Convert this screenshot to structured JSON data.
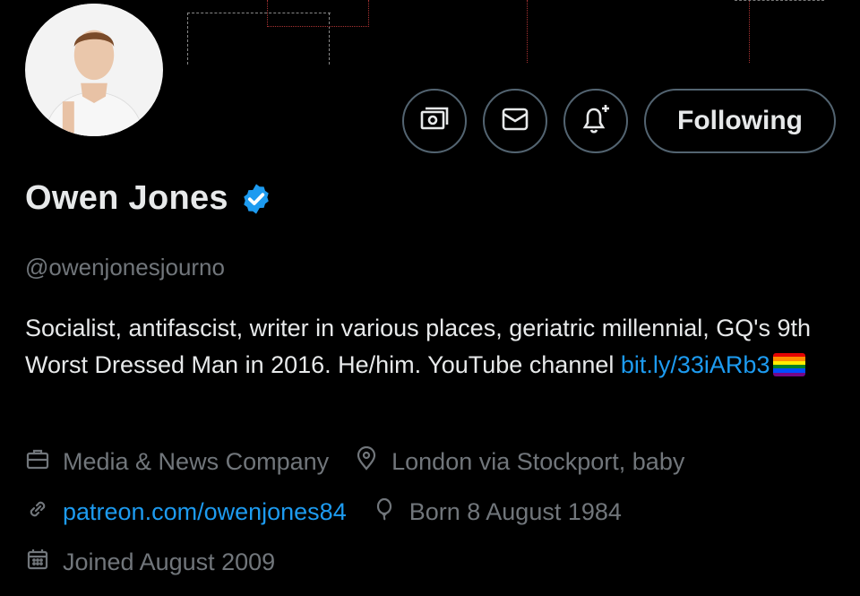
{
  "profile": {
    "name": "Owen Jones",
    "handle": "@owenjonesjourno",
    "bio_text": "Socialist, antifascist, writer in various places, geriatric millennial, GQ's 9th Worst Dressed Man in 2016. He/him. YouTube channel ",
    "bio_link": "bit.ly/33iARb3",
    "category": "Media & News Company",
    "location": "London via Stockport, baby",
    "website": "patreon.com/owenjones84",
    "birthday": "Born 8 August 1984",
    "joined": "Joined August 2009"
  },
  "actions": {
    "follow_label": "Following"
  },
  "icons": {
    "subscribe": "money-icon",
    "message": "envelope-icon",
    "notify": "bell-plus-icon",
    "verified": "verified-badge-icon",
    "category": "briefcase-icon",
    "location": "location-pin-icon",
    "website": "link-icon",
    "birthday": "balloon-icon",
    "joined": "calendar-icon"
  },
  "colors": {
    "background": "#000000",
    "primary_text": "#e7e9ea",
    "secondary_text": "#71767b",
    "link": "#1d9bf0",
    "button_border": "#536471",
    "verified": "#1d9bf0"
  }
}
